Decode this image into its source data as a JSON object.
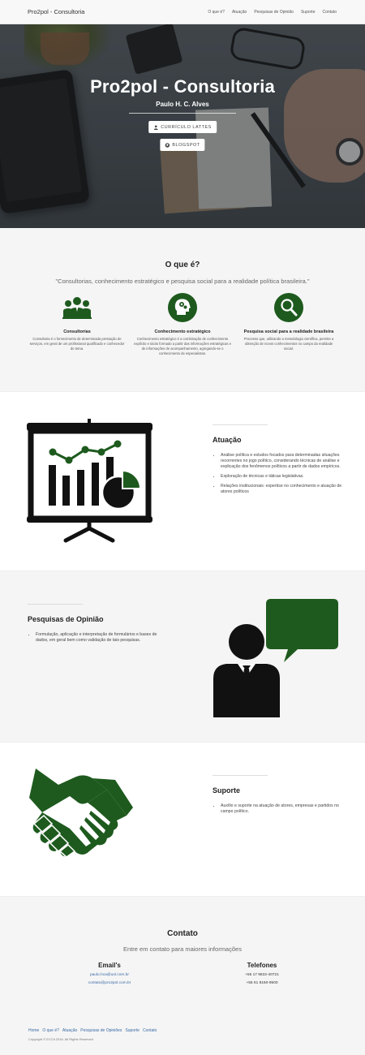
{
  "navbar": {
    "brand": "Pro2pol - Consultoria",
    "links": [
      "O que é?",
      "Atuação",
      "Pesquisas de Opinião",
      "Suporte",
      "Contato"
    ]
  },
  "hero": {
    "title": "Pro2pol - Consultoria",
    "subtitle": "Paulo H. C. Alves",
    "buttons": [
      {
        "label": "CURRÍCULO LATTES",
        "icon": "user-icon"
      },
      {
        "label": "BLOGSPOT",
        "icon": "globe-icon"
      }
    ]
  },
  "oque": {
    "title": "O que é?",
    "quote": "\"Consultorias, conhecimento estratégico e pesquisa social para a realidade política brasileira.\"",
    "columns": [
      {
        "icon": "people-icon",
        "title": "Consultorias",
        "text": "Consultoria é o fornecimento de determinada prestação de serviços, em geral de um profissional qualificado e conhecedor do tema."
      },
      {
        "icon": "head-gears-icon",
        "title": "Conhecimento estratégico",
        "text": "Conhecimento estratégico é a combinação de conhecimento explícito e tácito formado a partir das informações estratégicas e de informações de acompanhamento, agregando-se o conhecimento de especialistas."
      },
      {
        "icon": "magnifier-icon",
        "title": "Pesquisa social para a realidade brasileira",
        "text": "Processo que, utilizando a metodologia científica, permite a obtenção de novos conhecimentos no campo da realidade social."
      }
    ]
  },
  "atuacao": {
    "title": "Atuação",
    "items": [
      "Análise política e estudos focados para determinadas situações recorrentes no jogo político, considerando técnicas de análise e explicação dos fenômenos políticos a partir de dados empíricos.",
      "Exploração de técnicas e táticas legislativas.",
      "Relações institucionais: expertise no conhecimento e atuação de atores políticos"
    ]
  },
  "pesquisas": {
    "title": "Pesquisas de Opinião",
    "items": [
      "Formulação, aplicação e interpretação de formulários e bases de dados, em geral bem como validação de tais pesquisas."
    ]
  },
  "suporte": {
    "title": "Suporte",
    "items": [
      "Auxílio e suporte na atuação de atores, empresas e partidos no campo político."
    ]
  },
  "contato": {
    "title": "Contato",
    "subtitle": "Entre em contato para maiores informações",
    "emails_title": "Email's",
    "emails": [
      "paulo.hca@uol.com.br",
      "contato@pro2pol.com.br"
    ],
    "phones_title": "Telefones",
    "phones": [
      "+55 17 9822-40721",
      "+55 61 8160-9500"
    ]
  },
  "footer": {
    "links": [
      "Home",
      "O que é?",
      "Atuação",
      "Pesquisas de Opiniões",
      "Suporte",
      "Contato"
    ],
    "copyright": "Copyright © ECCit 2016. All Rights Reserved"
  },
  "colors": {
    "accent": "#1e5a1e",
    "icon_dark": "#111111"
  }
}
